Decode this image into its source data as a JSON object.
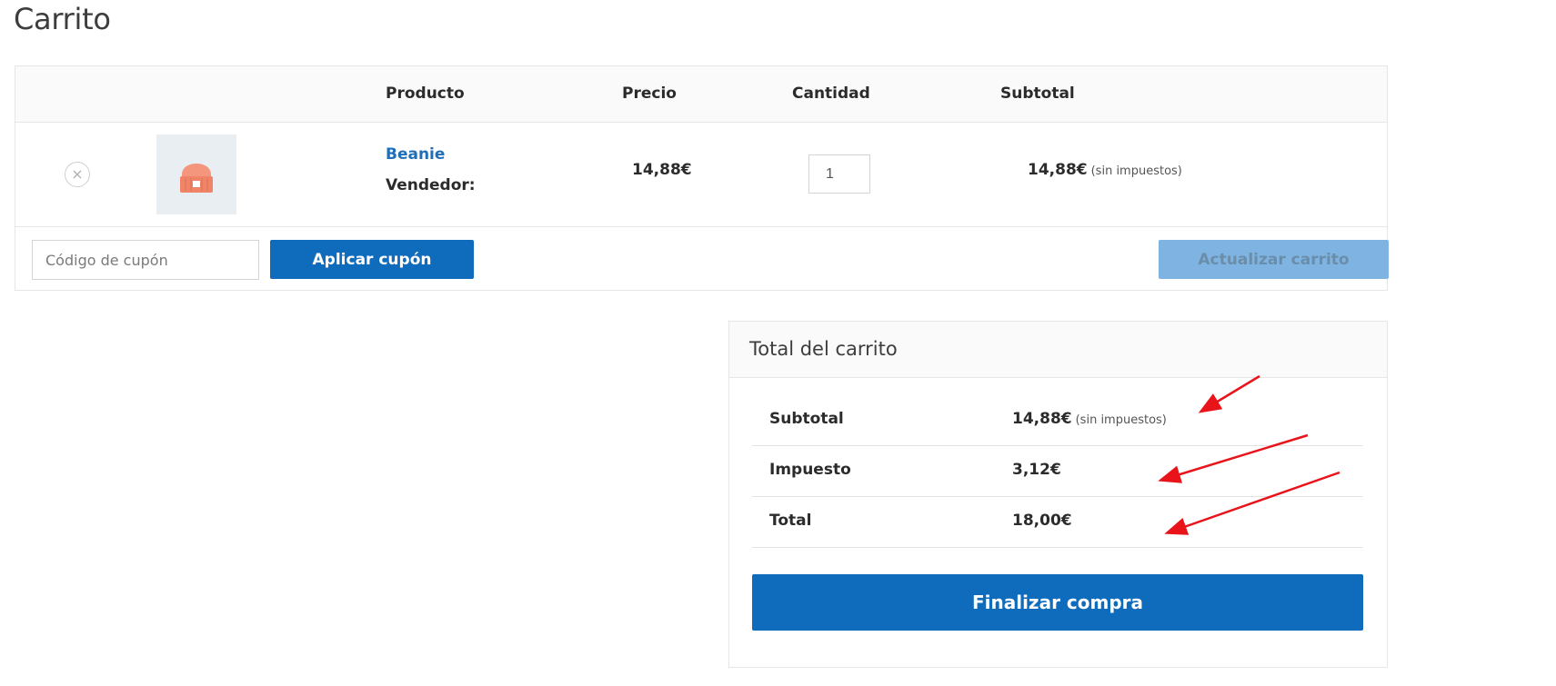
{
  "page": {
    "title": "Carrito"
  },
  "cart_table": {
    "headers": {
      "product": "Producto",
      "price": "Precio",
      "quantity": "Cantidad",
      "subtotal": "Subtotal"
    },
    "items": [
      {
        "remove_symbol": "×",
        "name": "Beanie",
        "vendor_label": "Vendedor:",
        "price": "14,88€",
        "quantity": "1",
        "subtotal": "14,88€",
        "subtotal_note": "(sin impuestos)",
        "thumbnail_icon": "beanie-hat-icon",
        "thumbnail_color": "#f08a72"
      }
    ],
    "coupon": {
      "placeholder": "Código de cupón",
      "value": ""
    },
    "apply_coupon_label": "Aplicar cupón",
    "update_cart_label": "Actualizar carrito"
  },
  "cart_totals": {
    "title": "Total del carrito",
    "rows": [
      {
        "label": "Subtotal",
        "value": "14,88€",
        "note": "(sin impuestos)"
      },
      {
        "label": "Impuesto",
        "value": "3,12€",
        "note": ""
      },
      {
        "label": "Total",
        "value": "18,00€",
        "note": ""
      }
    ],
    "checkout_label": "Finalizar compra"
  },
  "colors": {
    "primary": "#0f6cbd",
    "primary_disabled": "#7fb4e2",
    "link": "#1e6fb8",
    "annotation_arrow": "#e8141a"
  }
}
